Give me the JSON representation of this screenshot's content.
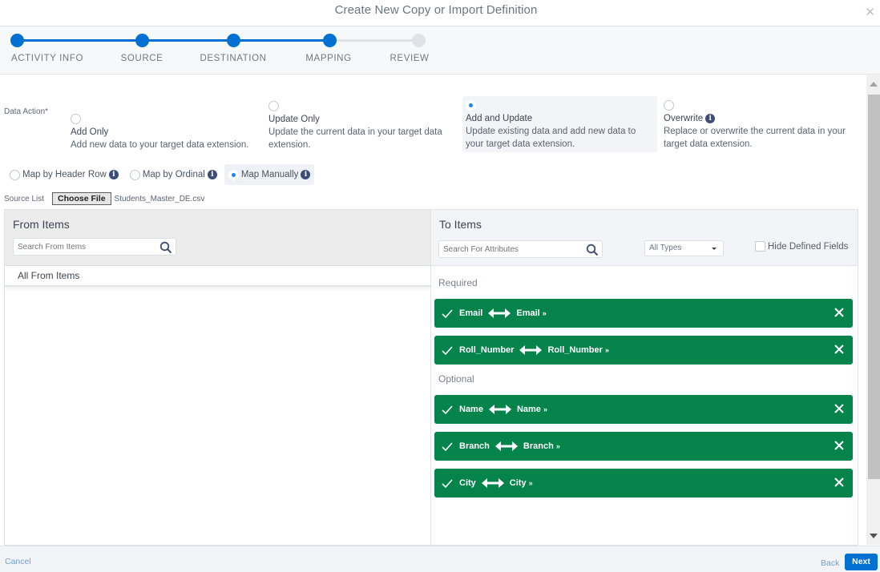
{
  "modal": {
    "title": "Create New Copy or Import Definition",
    "close_icon": "close-icon"
  },
  "stepper": {
    "steps": [
      {
        "label": "ACTIVITY INFO",
        "state": "complete"
      },
      {
        "label": "SOURCE",
        "state": "complete"
      },
      {
        "label": "DESTINATION",
        "state": "complete"
      },
      {
        "label": "MAPPING",
        "state": "current"
      },
      {
        "label": "REVIEW",
        "state": "incomplete"
      }
    ],
    "active_color": "#0070d2",
    "inactive_color": "#dfe3e8"
  },
  "data_action": {
    "label": "Data Action*",
    "options": [
      {
        "title": "Add Only",
        "description": "Add new data to your target data extension.",
        "selected": false
      },
      {
        "title": "Update Only",
        "description": "Update the current data in your target data extension.",
        "selected": false
      },
      {
        "title": "Add and Update",
        "description": "Update existing data and add new data to your target data extension.",
        "selected": true
      },
      {
        "title": "Overwrite",
        "description": "Replace or overwrite the current data in your target data extension.",
        "selected": false,
        "info": true
      }
    ]
  },
  "mapping_mode": {
    "options": [
      {
        "label": "Map by Header Row",
        "selected": false
      },
      {
        "label": "Map by Ordinal",
        "selected": false
      },
      {
        "label": "Map Manually",
        "selected": true
      }
    ]
  },
  "source": {
    "label": "Source List",
    "choose_file_label": "Choose File",
    "file_name": "Students_Master_DE.csv"
  },
  "from_panel": {
    "title": "From Items",
    "search_placeholder": "Search From Items",
    "all_items_label": "All From Items"
  },
  "to_panel": {
    "title": "To Items",
    "search_placeholder": "Search For Attributes",
    "type_filter": "All Types",
    "hide_defined_label": "Hide Defined Fields",
    "hide_defined_checked": false,
    "required_label": "Required",
    "optional_label": "Optional",
    "required_mappings": [
      {
        "source": "Email",
        "target": "Email"
      },
      {
        "source": "Roll_Number",
        "target": "Roll_Number"
      }
    ],
    "optional_mappings": [
      {
        "source": "Name",
        "target": "Name"
      },
      {
        "source": "Branch",
        "target": "Branch"
      },
      {
        "source": "City",
        "target": "City"
      }
    ],
    "mapped_color": "#04844b",
    "target_suffix": "»"
  },
  "footer": {
    "cancel_label": "Cancel",
    "back_label": "Back",
    "next_label": "Next"
  }
}
